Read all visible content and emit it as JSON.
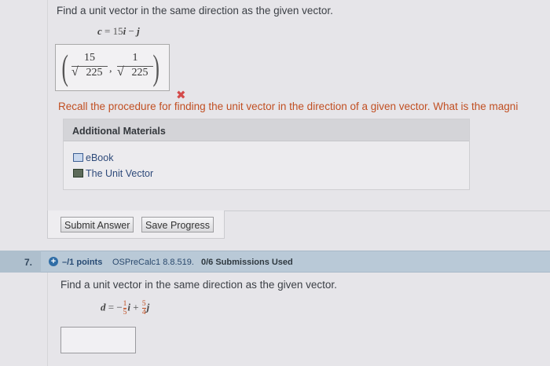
{
  "q6": {
    "prompt": "Find a unit vector in the same direction as the given vector.",
    "given_lhs": "c",
    "given_eq": " = ",
    "given_rhs_a": "15",
    "given_i": "i",
    "given_minus": " − ",
    "given_j": "j",
    "answer": {
      "num1": "15",
      "den1": "225",
      "num2": "1",
      "den2": "225",
      "sep": ","
    },
    "status": "✖",
    "feedback": "Recall the procedure for finding the unit vector in the direction of a given vector. What is the magni"
  },
  "additional_materials": {
    "title": "Additional Materials",
    "items": [
      {
        "label": "eBook",
        "icon": "ebook-icon"
      },
      {
        "label": "The Unit Vector",
        "icon": "document-icon"
      }
    ]
  },
  "buttons": {
    "submit": "Submit Answer",
    "save": "Save Progress"
  },
  "q7": {
    "number": "7.",
    "plus": "+",
    "points": "–/1 points",
    "source": "OSPreCalc1 8.8.519.",
    "submissions": "0/6 Submissions Used",
    "prompt": "Find a unit vector in the same direction as the given vector.",
    "given_lhs": "d",
    "given_eq": " = −",
    "frac1_num": "1",
    "frac1_den": "5",
    "given_i": "i",
    "given_plus": " + ",
    "frac2_num": "5",
    "frac2_den": "4",
    "given_j": "j"
  },
  "colors": {
    "accent": "#c14f22",
    "header_bar": "#b9c9d7",
    "link": "#2e4a7a",
    "error": "#d44b4b"
  }
}
